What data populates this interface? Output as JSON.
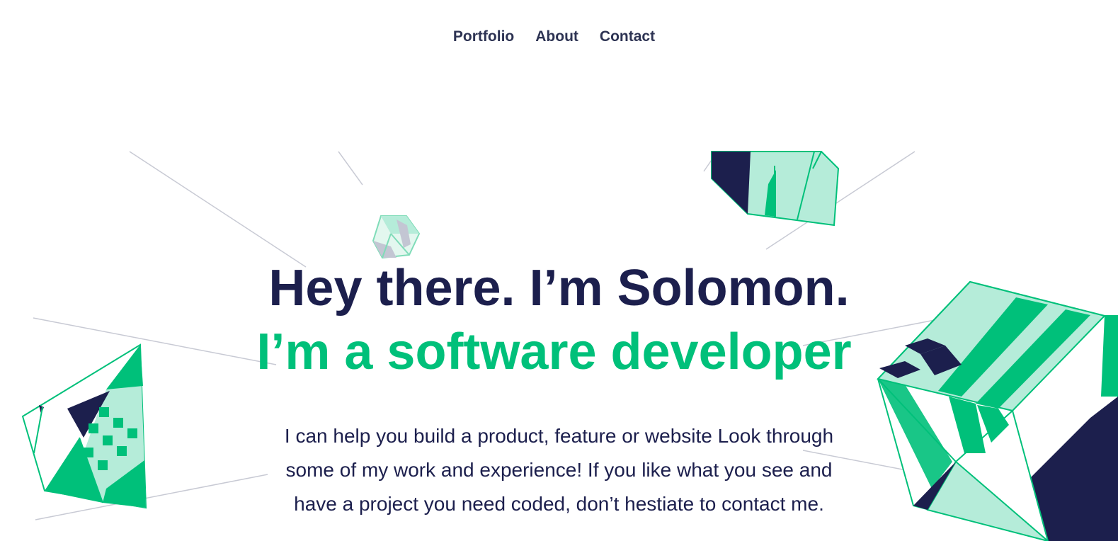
{
  "nav": {
    "items": [
      {
        "label": "Portfolio"
      },
      {
        "label": "About"
      },
      {
        "label": "Contact"
      }
    ]
  },
  "hero": {
    "headline": "Hey there. I’m Solomon.",
    "subheadline": "I’m a software developer",
    "intro": "I can help you build a product, feature or website Look through some of my work and experience! If you like what you see and have a project you need coded, don’t hestiate to contact me."
  },
  "colors": {
    "navy": "#1c1f4d",
    "green": "#00c07a",
    "mint": "#b5ecd9",
    "line": "#c8cad4"
  },
  "decorations": [
    "geometric-cube-graphic",
    "thin-line-graphic"
  ]
}
